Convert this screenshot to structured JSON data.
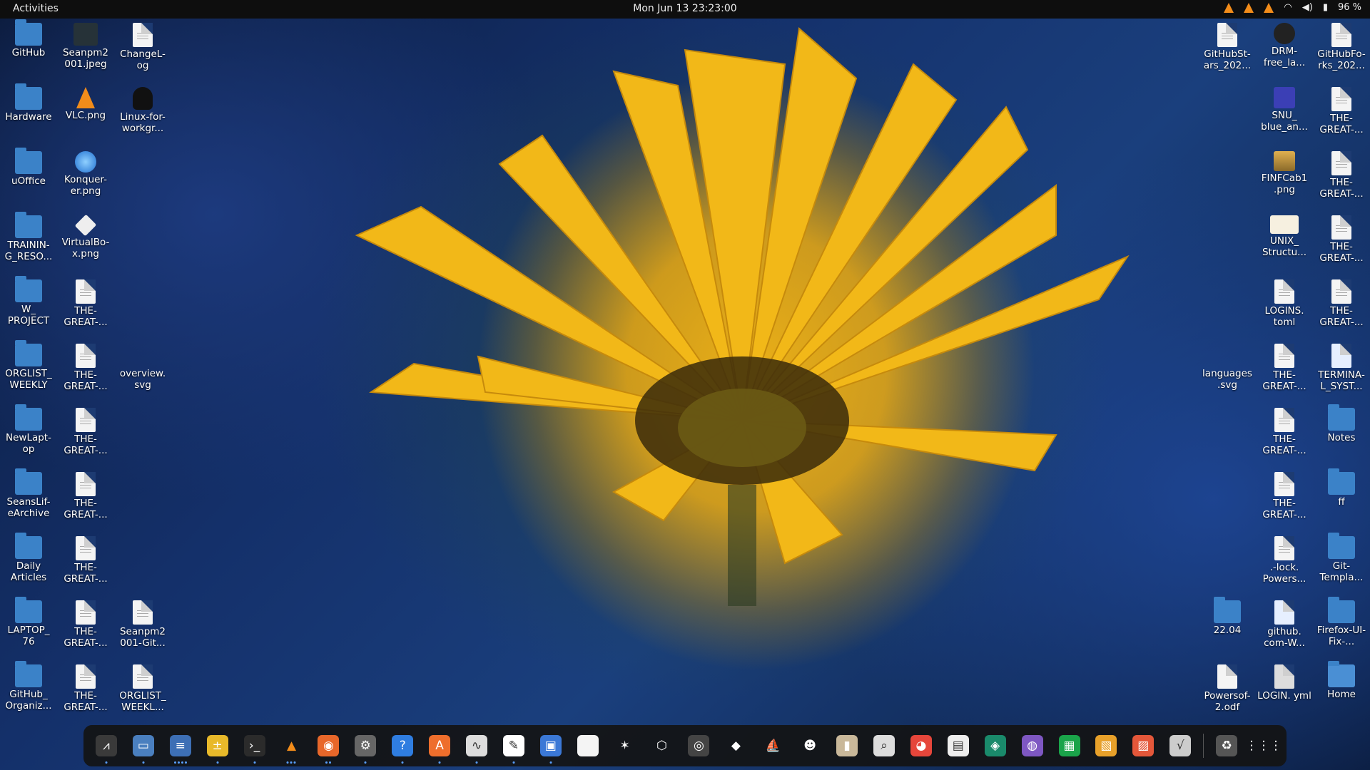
{
  "topbar": {
    "activities": "Activities",
    "clock": "Mon Jun 13  23:23:00",
    "battery": "96 %"
  },
  "left_col1": [
    {
      "label": "GitHub",
      "type": "folder"
    },
    {
      "label": "Hardware",
      "type": "folder"
    },
    {
      "label": "uOffice",
      "type": "folder"
    },
    {
      "label": "TRAININ-G_RESO...",
      "type": "folder"
    },
    {
      "label": "W_ PROJECT",
      "type": "folder"
    },
    {
      "label": "ORGLIST_ WEEKLY",
      "type": "folder"
    },
    {
      "label": "NewLapt-op",
      "type": "folder"
    },
    {
      "label": "SeansLif-eArchive",
      "type": "folder"
    },
    {
      "label": "Daily Articles",
      "type": "folder"
    },
    {
      "label": "LAPTOP_ 76",
      "type": "folder"
    },
    {
      "label": "GitHub_ Organiz...",
      "type": "folder"
    }
  ],
  "left_col2": [
    {
      "label": "Seanpm2 001.jpeg",
      "type": "photo"
    },
    {
      "label": "VLC.png",
      "type": "vlc"
    },
    {
      "label": "Konquer-er.png",
      "type": "globe"
    },
    {
      "label": "VirtualBo-x.png",
      "type": "vbox"
    },
    {
      "label": "THE-GREAT-...",
      "type": "doc"
    },
    {
      "label": "THE-GREAT-...",
      "type": "doc"
    },
    {
      "label": "THE-GREAT-...",
      "type": "doc"
    },
    {
      "label": "THE-GREAT-...",
      "type": "doc"
    },
    {
      "label": "THE-GREAT-...",
      "type": "doc"
    },
    {
      "label": "THE-GREAT-...",
      "type": "doc"
    },
    {
      "label": "THE-GREAT-...",
      "type": "doc"
    }
  ],
  "left_col3": [
    {
      "label": "ChangeL-og",
      "type": "doc",
      "row": 0
    },
    {
      "label": "Linux-for-workgr...",
      "type": "tux",
      "row": 1
    },
    {
      "label": "overview. svg",
      "type": "none",
      "row": 5
    },
    {
      "label": "Seanpm2 001-Git...",
      "type": "doc",
      "row": 9
    },
    {
      "label": "ORGLIST_ WEEKL...",
      "type": "doc",
      "row": 10
    }
  ],
  "right_col1": [
    {
      "label": "GitHubSt-ars_202...",
      "type": "doc",
      "row": 0
    },
    {
      "label": "languages .svg",
      "type": "none",
      "row": 5
    },
    {
      "label": "22.04",
      "type": "folder",
      "row": 9
    },
    {
      "label": "Powersof-2.odf",
      "type": "formula",
      "row": 10
    }
  ],
  "right_col2": [
    {
      "label": "DRM-free_la...",
      "type": "dark",
      "row": 0
    },
    {
      "label": "SNU_ blue_an...",
      "type": "snu",
      "row": 1
    },
    {
      "label": "FINFCab1 .png",
      "type": "cab",
      "row": 2
    },
    {
      "label": "UNIX_ Structu...",
      "type": "chart",
      "row": 3
    },
    {
      "label": "LOGINS. toml",
      "type": "doc",
      "row": 4
    },
    {
      "label": "THE-GREAT-...",
      "type": "doc",
      "row": 5
    },
    {
      "label": "THE-GREAT-...",
      "type": "doc",
      "row": 6
    },
    {
      "label": "THE-GREAT-...",
      "type": "doc",
      "row": 7
    },
    {
      "label": ".-lock. Powers...",
      "type": "doc",
      "row": 8
    },
    {
      "label": "github. com-W...",
      "type": "code",
      "row": 9
    },
    {
      "label": "LOGIN. yml",
      "type": "db",
      "row": 10
    }
  ],
  "right_col3": [
    {
      "label": "GitHubFo-rks_202...",
      "type": "doc",
      "row": 0
    },
    {
      "label": "THE-GREAT-...",
      "type": "doc",
      "row": 1
    },
    {
      "label": "THE-GREAT-...",
      "type": "doc",
      "row": 2
    },
    {
      "label": "THE-GREAT-...",
      "type": "doc",
      "row": 3
    },
    {
      "label": "THE-GREAT-...",
      "type": "doc",
      "row": 4
    },
    {
      "label": "TERMINA-L_SYST...",
      "type": "code",
      "row": 5
    },
    {
      "label": "Notes",
      "type": "folder",
      "row": 6
    },
    {
      "label": "ff",
      "type": "folder",
      "row": 7
    },
    {
      "label": "Git-Templa...",
      "type": "folder",
      "row": 8
    },
    {
      "label": "Firefox-UI-Fix-...",
      "type": "folder",
      "row": 9
    },
    {
      "label": "Home",
      "type": "home",
      "row": 10
    }
  ],
  "dock": [
    {
      "name": "system-monitor",
      "bg": "#3a3a3a",
      "glyph": "⩘",
      "dots": 1
    },
    {
      "name": "files",
      "bg": "#4a7fbf",
      "glyph": "▭",
      "dots": 1
    },
    {
      "name": "text-editor",
      "bg": "#3d6fb5",
      "glyph": "≡",
      "dots": 4
    },
    {
      "name": "calculator",
      "bg": "#e8b92a",
      "glyph": "±",
      "dots": 1
    },
    {
      "name": "terminal",
      "bg": "#2b2b2b",
      "glyph": "›_",
      "dots": 1
    },
    {
      "name": "vlc",
      "bg": "transparent",
      "glyph": "▲",
      "dots": 3
    },
    {
      "name": "firefox",
      "bg": "#e8672a",
      "glyph": "◉",
      "dots": 2
    },
    {
      "name": "settings",
      "bg": "#666",
      "glyph": "⚙",
      "dots": 1
    },
    {
      "name": "help",
      "bg": "#2f7de0",
      "glyph": "?",
      "dots": 1
    },
    {
      "name": "software",
      "bg": "#ee6e2c",
      "glyph": "A",
      "dots": 1
    },
    {
      "name": "performance",
      "bg": "#ddd",
      "glyph": "∿",
      "dots": 1
    },
    {
      "name": "notes-editor",
      "bg": "#fff",
      "glyph": "✎",
      "dots": 1
    },
    {
      "name": "control-center",
      "bg": "#3b78d6",
      "glyph": "▣",
      "dots": 1
    },
    {
      "name": "blank-document",
      "bg": "#f4f4f4",
      "glyph": "",
      "dots": 0
    },
    {
      "name": "gimp",
      "bg": "transparent",
      "glyph": "✶",
      "dots": 0
    },
    {
      "name": "virtualbox",
      "bg": "transparent",
      "glyph": "⬡",
      "dots": 0
    },
    {
      "name": "screenshot",
      "bg": "#444",
      "glyph": "◎",
      "dots": 0
    },
    {
      "name": "inkscape",
      "bg": "transparent",
      "glyph": "◆",
      "dots": 0
    },
    {
      "name": "game-ship",
      "bg": "transparent",
      "glyph": "⛵",
      "dots": 0
    },
    {
      "name": "game-mario",
      "bg": "transparent",
      "glyph": "☻",
      "dots": 0
    },
    {
      "name": "archive-manager",
      "bg": "#c9b89a",
      "glyph": "▮",
      "dots": 0
    },
    {
      "name": "image-viewer",
      "bg": "#ddd",
      "glyph": "⌕",
      "dots": 0
    },
    {
      "name": "chrome",
      "bg": "#e6463b",
      "glyph": "◕",
      "dots": 0
    },
    {
      "name": "typora",
      "bg": "#eee",
      "glyph": "▤",
      "dots": 0
    },
    {
      "name": "edu-app",
      "bg": "#1a8a6b",
      "glyph": "◈",
      "dots": 0
    },
    {
      "name": "tor-browser",
      "bg": "#7e57c2",
      "glyph": "◍",
      "dots": 0
    },
    {
      "name": "spreadsheet",
      "bg": "#1aa44a",
      "glyph": "▦",
      "dots": 0
    },
    {
      "name": "draw",
      "bg": "#e8a12a",
      "glyph": "▧",
      "dots": 0
    },
    {
      "name": "impress",
      "bg": "#e4573a",
      "glyph": "▨",
      "dots": 0
    },
    {
      "name": "math",
      "bg": "#ccc",
      "glyph": "√",
      "dots": 0
    },
    {
      "name": "trash",
      "bg": "#555",
      "glyph": "♻",
      "dots": 0
    },
    {
      "name": "show-apps",
      "bg": "transparent",
      "glyph": "⋮⋮⋮",
      "dots": 0
    }
  ]
}
